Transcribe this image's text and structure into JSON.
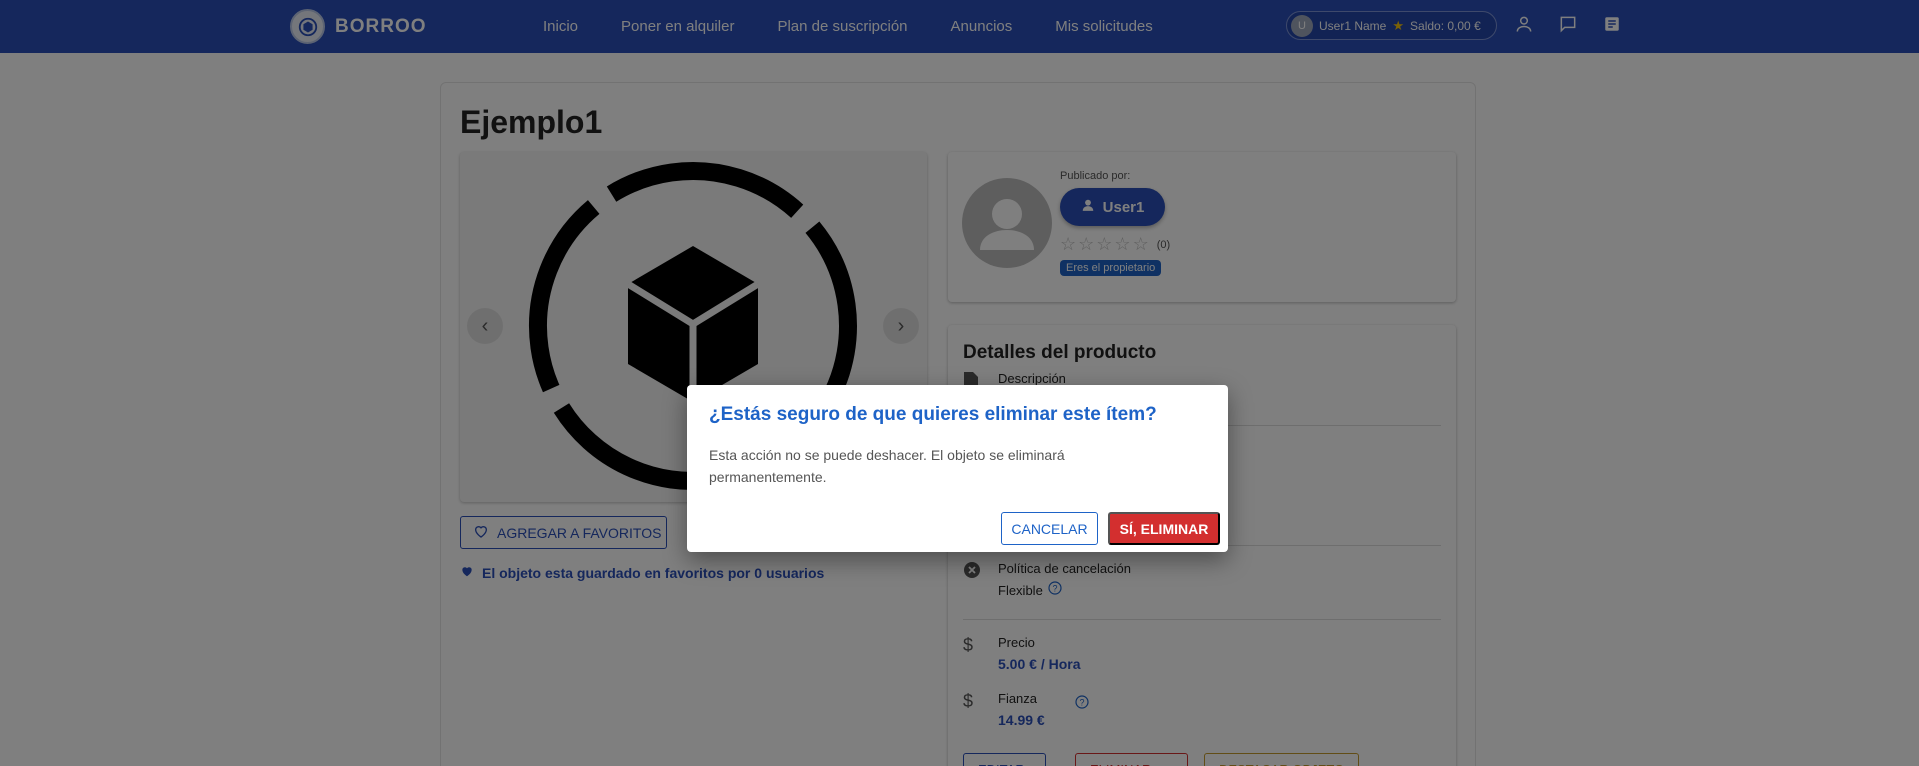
{
  "header": {
    "brand": "BORROO",
    "nav": [
      "Inicio",
      "Poner en alquiler",
      "Plan de suscripción",
      "Anuncios",
      "Mis solicitudes"
    ],
    "user": {
      "initial": "U",
      "name": "User1 Name",
      "balance": "Saldo: 0,00 €"
    }
  },
  "item": {
    "title": "Ejemplo1",
    "favorite_button": "AGREGAR A FAVORITOS",
    "favorites_info": "El objeto esta guardado en favoritos por 0 usuarios"
  },
  "owner": {
    "published_label": "Publicado por:",
    "username": "User1",
    "rating_count": "(0)",
    "rating": 0,
    "badge": "Eres el propietario"
  },
  "details": {
    "title": "Detalles del producto",
    "description_label": "Descripción",
    "cancel_policy_label": "Política de cancelación",
    "cancel_policy_value": "Flexible",
    "price_label": "Precio",
    "price_value": "5.00 € / Hora",
    "deposit_label": "Fianza",
    "deposit_value": "14.99 €",
    "actions": [
      "EDITAR",
      "ELIMINAR",
      "DESTACAR OBJETO"
    ]
  },
  "dialog": {
    "title": "¿Estás seguro de que quieres eliminar este ítem?",
    "body": "Esta acción no se puede deshacer. El objeto se eliminará permanentemente.",
    "cancel": "CANCELAR",
    "confirm": "SÍ, ELIMINAR"
  },
  "colors": {
    "brand": "#2a4fb9",
    "accent": "#1e63c7",
    "danger": "#d32f2f",
    "highlight": "#c49a2c"
  }
}
